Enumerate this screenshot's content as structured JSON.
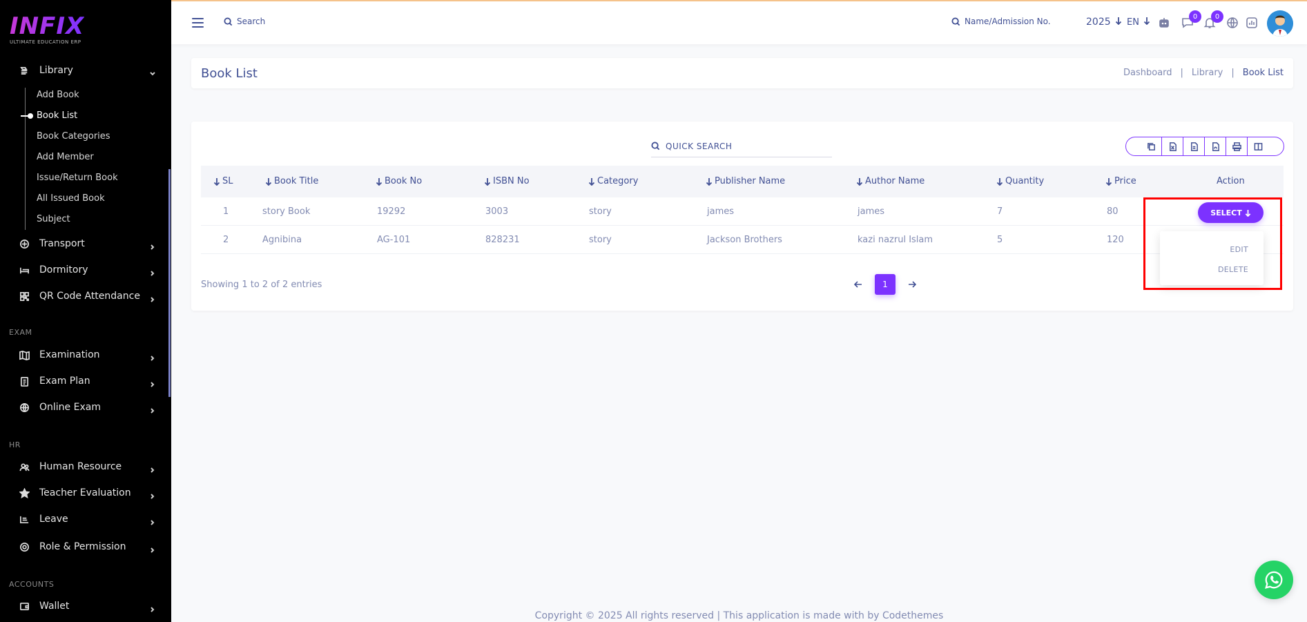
{
  "logo": {
    "word": "INFIX",
    "tagline": "ULTIMATE EDUCATION ERP"
  },
  "sidebar": {
    "library": {
      "label": "Library",
      "sub_items": [
        "Add Book",
        "Book List",
        "Book Categories",
        "Add Member",
        "Issue/Return Book",
        "All Issued Book",
        "Subject"
      ],
      "active_sub": "Book List"
    },
    "items_group1": [
      {
        "label": "Transport",
        "icon": "bus-icon"
      },
      {
        "label": "Dormitory",
        "icon": "bed-icon"
      },
      {
        "label": "QR Code Attendance",
        "icon": "qr-code-icon"
      }
    ],
    "section_exam": "EXAM",
    "items_exam": [
      {
        "label": "Examination",
        "icon": "map-icon"
      },
      {
        "label": "Exam Plan",
        "icon": "clipboard-icon"
      },
      {
        "label": "Online Exam",
        "icon": "globe-icon"
      }
    ],
    "section_hr": "HR",
    "items_hr": [
      {
        "label": "Human Resource",
        "icon": "users-icon"
      },
      {
        "label": "Teacher Evaluation",
        "icon": "star-icon"
      },
      {
        "label": "Leave",
        "icon": "leave-icon"
      },
      {
        "label": "Role & Permission",
        "icon": "permission-icon"
      }
    ],
    "section_accounts": "ACCOUNTS",
    "items_accounts": [
      {
        "label": "Wallet",
        "icon": "wallet-icon"
      }
    ]
  },
  "topbar": {
    "search_label": "Search",
    "name_search_label": "Name/Admission No.",
    "year": "2025",
    "language": "EN",
    "chat_badge": "0",
    "notification_badge": "0"
  },
  "page": {
    "title": "Book List",
    "breadcrumb": [
      "Dashboard",
      "Library",
      "Book List"
    ]
  },
  "table": {
    "quick_search_placeholder": "QUICK SEARCH",
    "columns": [
      "SL",
      "Book Title",
      "Book No",
      "ISBN No",
      "Category",
      "Publisher Name",
      "Author Name",
      "Quantity",
      "Price",
      "Action"
    ],
    "rows": [
      {
        "sl": "1",
        "title": "story Book",
        "book_no": "19292",
        "isbn": "3003",
        "category": "story",
        "publisher": "james",
        "author": "james",
        "quantity": "7",
        "price": "80"
      },
      {
        "sl": "2",
        "title": "Agnibina",
        "book_no": "AG-101",
        "isbn": "828231",
        "category": "story",
        "publisher": "Jackson Brothers",
        "author": "kazi nazrul Islam",
        "quantity": "5",
        "price": "120"
      }
    ],
    "select_label": "SELECT",
    "dropdown": [
      "EDIT",
      "DELETE"
    ],
    "showing_text": "Showing 1 to 2 of 2 entries",
    "current_page": "1"
  },
  "footer": "Copyright © 2025 All rights reserved | This application is made with by Codethemes",
  "colors": {
    "accent": "#7c32ff",
    "text": "#415094",
    "muted": "#828bb2",
    "highlight": "#ff0000"
  }
}
